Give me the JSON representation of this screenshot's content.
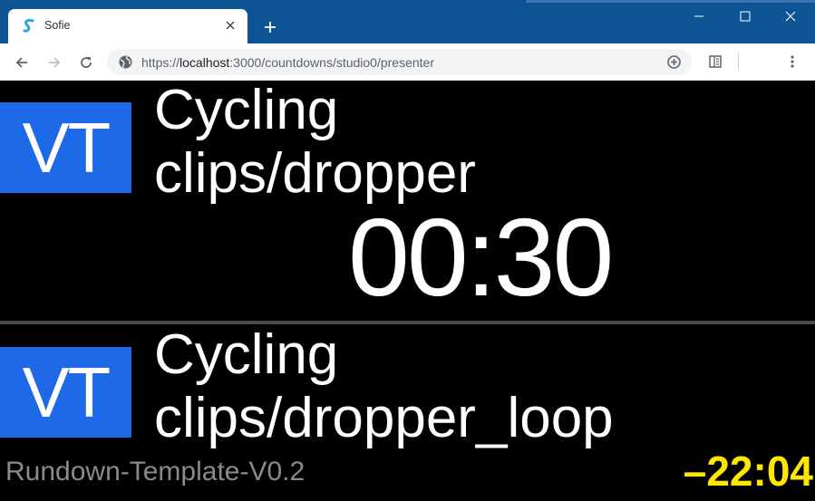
{
  "browser": {
    "tab_title": "Sofie",
    "url_scheme": "https://",
    "url_host": "localhost",
    "url_path": ":3000/countdowns/studio0/presenter",
    "icons": {
      "favicon": "sofie-logo-icon",
      "tab_close": "close-icon",
      "new_tab": "plus-icon",
      "minimize": "minimize-icon",
      "maximize": "maximize-icon",
      "close_window": "close-icon",
      "back": "arrow-left-icon",
      "forward": "arrow-right-icon",
      "reload": "reload-icon",
      "site_info": "globe-icon",
      "zoom": "zoom-in-icon",
      "reader": "reader-mode-icon",
      "menu": "kebab-menu-icon"
    },
    "colors": {
      "titlebar": "#0c5494",
      "toolbar": "#ffffff"
    }
  },
  "presenter": {
    "current_part": {
      "type_label": "VT",
      "title_line1": "Cycling",
      "title_line2": "clips/dropper"
    },
    "part_countdown": "00:30",
    "next_part": {
      "type_label": "VT",
      "title_line1": "Cycling",
      "title_line2": "clips/dropper_loop"
    },
    "rundown_name": "Rundown-Template-V0.2",
    "over_under": "–22:04",
    "colors": {
      "vt_badge": "#1e69e8",
      "over_under": "#ffe600",
      "background": "#000000"
    }
  }
}
